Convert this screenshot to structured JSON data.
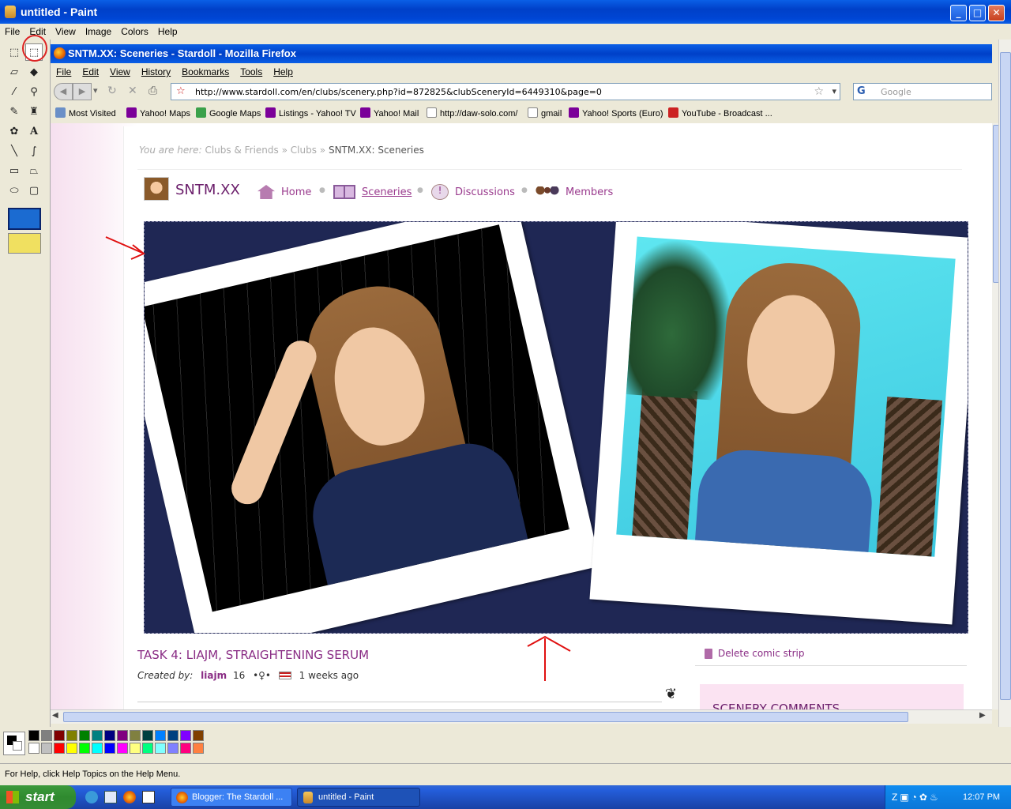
{
  "paint": {
    "title": "untitled - Paint",
    "menu": [
      "File",
      "Edit",
      "View",
      "Image",
      "Colors",
      "Help"
    ],
    "status": "For Help, click Help Topics on the Help Menu.",
    "palette_top": [
      "#000000",
      "#808080",
      "#800000",
      "#808000",
      "#008000",
      "#008080",
      "#000080",
      "#800080",
      "#808040",
      "#004040",
      "#0080ff",
      "#004080",
      "#8000ff",
      "#804000"
    ],
    "palette_bottom": [
      "#ffffff",
      "#c0c0c0",
      "#ff0000",
      "#ffff00",
      "#00ff00",
      "#00ffff",
      "#0000ff",
      "#ff00ff",
      "#ffff80",
      "#00ff80",
      "#80ffff",
      "#8080ff",
      "#ff0080",
      "#ff8040"
    ]
  },
  "firefox": {
    "title": "SNTM.XX: Sceneries - Stardoll - Mozilla Firefox",
    "menu": [
      "File",
      "Edit",
      "View",
      "History",
      "Bookmarks",
      "Tools",
      "Help"
    ],
    "url": "http://www.stardoll.com/en/clubs/scenery.php?id=872825&clubSceneryId=6449310&page=0",
    "search_placeholder": "Google",
    "bookmarks": [
      "Most Visited",
      "Yahoo! Maps",
      "Google Maps",
      "Listings - Yahoo! TV",
      "Yahoo! Mail",
      "http://daw-solo.com/",
      "gmail",
      "Yahoo! Sports (Euro)",
      "YouTube - Broadcast ..."
    ]
  },
  "page": {
    "crumb_prefix": "You are here:",
    "crumb_1": "Clubs & Friends",
    "crumb_sep": "»",
    "crumb_2": "Clubs",
    "crumb_3": "SNTM.XX: Sceneries",
    "club_name": "SNTM.XX",
    "nav": [
      "Home",
      "Sceneries",
      "Discussions",
      "Members"
    ],
    "task_title": "TASK 4: LIAJM, STRAIGHTENING SERUM",
    "created_label": "Created by:",
    "creator": "liajm",
    "creator_age": "16",
    "time_ago": "1 weeks ago",
    "delete_label": "Delete comic strip",
    "comments_title": "SCENERY COMMENTS"
  },
  "taskbar": {
    "start": "start",
    "tasks": [
      "Blogger: The Stardoll ...",
      "untitled - Paint"
    ],
    "clock": "12:07 PM"
  }
}
